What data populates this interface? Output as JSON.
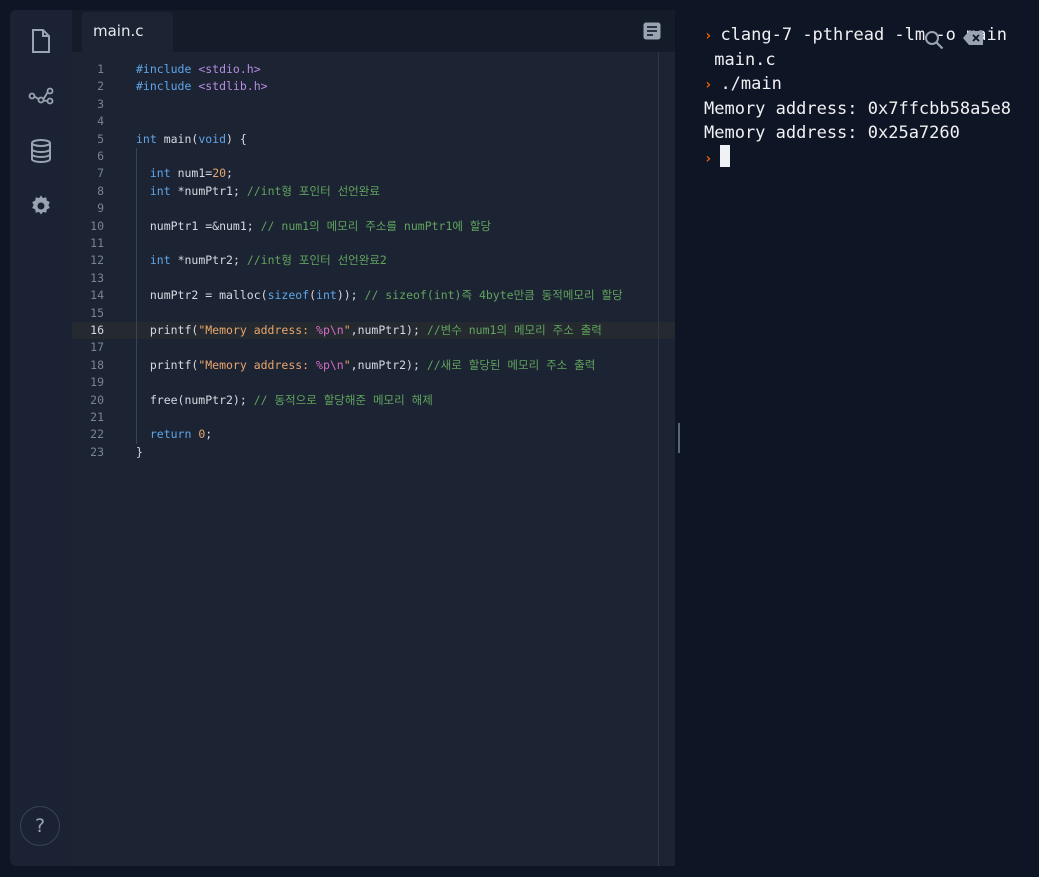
{
  "sidebar": {
    "icons": [
      "file-icon",
      "share-icon",
      "database-icon",
      "settings-icon"
    ],
    "help_label": "?"
  },
  "editor": {
    "tab_label": "main.c",
    "active_line": 16,
    "lines": [
      {
        "n": "1",
        "parts": [
          [
            "pp",
            "#include "
          ],
          [
            "inc",
            "<stdio.h>"
          ]
        ]
      },
      {
        "n": "2",
        "parts": [
          [
            "pp",
            "#include "
          ],
          [
            "inc",
            "<stdlib.h>"
          ]
        ]
      },
      {
        "n": "3",
        "parts": []
      },
      {
        "n": "4",
        "parts": []
      },
      {
        "n": "5",
        "parts": [
          [
            "kw",
            "int"
          ],
          [
            "",
            " main("
          ],
          [
            "kw",
            "void"
          ],
          [
            "",
            ") {"
          ]
        ]
      },
      {
        "n": "6",
        "parts": []
      },
      {
        "n": "7",
        "parts": [
          [
            "",
            "  "
          ],
          [
            "kw",
            "int"
          ],
          [
            "",
            " num1="
          ],
          [
            "str",
            "20"
          ],
          [
            "",
            ";"
          ]
        ]
      },
      {
        "n": "8",
        "parts": [
          [
            "",
            "  "
          ],
          [
            "kw",
            "int"
          ],
          [
            "",
            " *numPtr1; "
          ],
          [
            "cmt",
            "//int형 포인터 선언완료"
          ]
        ]
      },
      {
        "n": "9",
        "parts": []
      },
      {
        "n": "10",
        "parts": [
          [
            "",
            "  numPtr1 =&num1; "
          ],
          [
            "cmt",
            "// num1의 메모리 주소를 numPtr1에 할당"
          ]
        ]
      },
      {
        "n": "11",
        "parts": []
      },
      {
        "n": "12",
        "parts": [
          [
            "",
            "  "
          ],
          [
            "kw",
            "int"
          ],
          [
            "",
            " *numPtr2; "
          ],
          [
            "cmt",
            "//int형 포인터 선언완료2"
          ]
        ]
      },
      {
        "n": "13",
        "parts": []
      },
      {
        "n": "14",
        "parts": [
          [
            "",
            "  numPtr2 = malloc("
          ],
          [
            "kw",
            "sizeof"
          ],
          [
            "",
            "("
          ],
          [
            "kw",
            "int"
          ],
          [
            "",
            ")); "
          ],
          [
            "cmt",
            "// sizeof(int)즉 4byte만큼 동적메모리 할당"
          ]
        ]
      },
      {
        "n": "15",
        "parts": []
      },
      {
        "n": "16",
        "parts": [
          [
            "",
            "  printf("
          ],
          [
            "str",
            "\"Memory address: "
          ],
          [
            "fmt",
            "%p\\n"
          ],
          [
            "str",
            "\""
          ],
          [
            "",
            ",numPtr1); "
          ],
          [
            "cmt",
            "//변수 num1의 메모리 주소 출력"
          ]
        ]
      },
      {
        "n": "17",
        "parts": []
      },
      {
        "n": "18",
        "parts": [
          [
            "",
            "  printf("
          ],
          [
            "str",
            "\"Memory address: "
          ],
          [
            "fmt",
            "%p\\n"
          ],
          [
            "str",
            "\""
          ],
          [
            "",
            ",numPtr2); "
          ],
          [
            "cmt",
            "//새로 할당된 메모리 주소 출력"
          ]
        ]
      },
      {
        "n": "19",
        "parts": []
      },
      {
        "n": "20",
        "parts": [
          [
            "",
            "  free(numPtr2); "
          ],
          [
            "cmt",
            "// 동적으로 할당해준 메모리 해제"
          ]
        ]
      },
      {
        "n": "21",
        "parts": []
      },
      {
        "n": "22",
        "parts": [
          [
            "",
            "  "
          ],
          [
            "kw",
            "return"
          ],
          [
            "",
            " "
          ],
          [
            "str",
            "0"
          ],
          [
            "",
            ";"
          ]
        ]
      },
      {
        "n": "23",
        "parts": [
          [
            "",
            "}"
          ]
        ]
      }
    ]
  },
  "console": {
    "lines": [
      {
        "prompt": true,
        "text": "clang-7 -pthread -lm -o main"
      },
      {
        "prompt": false,
        "text": " main.c"
      },
      {
        "prompt": true,
        "text": "./main"
      },
      {
        "prompt": false,
        "text": "Memory address: 0x7ffcbb58a5e8"
      },
      {
        "prompt": false,
        "text": "Memory address: 0x25a7260"
      }
    ],
    "prompt_symbol": "›",
    "tools": [
      "search-icon",
      "clear-icon"
    ]
  },
  "colors": {
    "prompt": "#f26207",
    "keyword": "#5ea6e8",
    "string": "#e8a66d",
    "comment": "#61a45e"
  }
}
